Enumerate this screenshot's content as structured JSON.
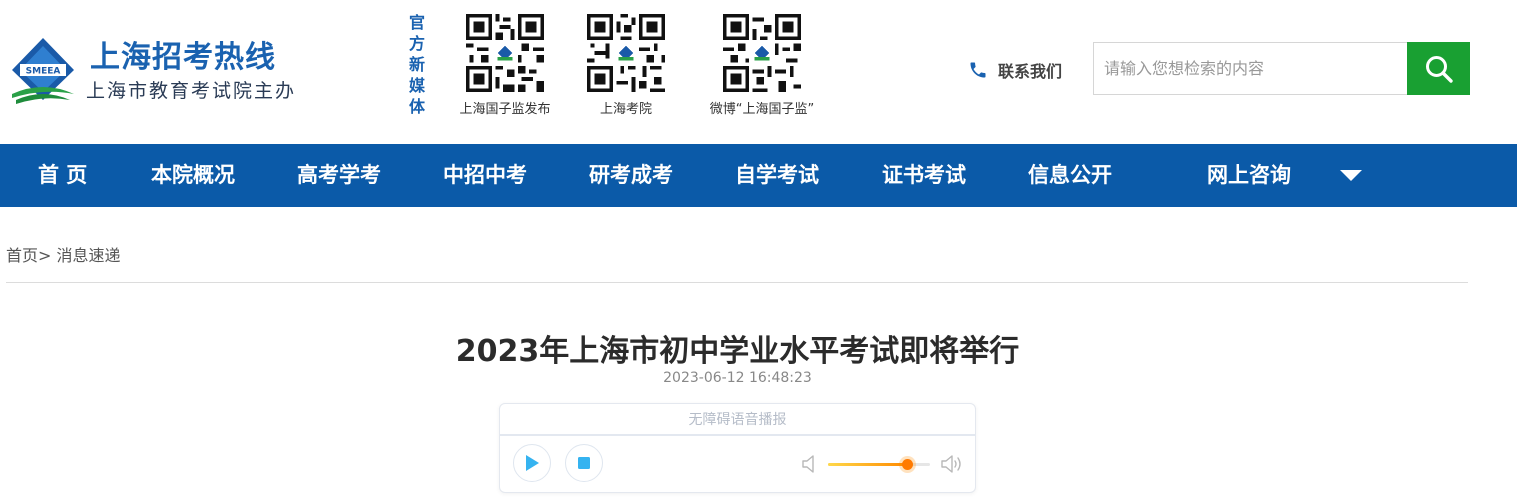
{
  "header": {
    "logo_title": "上海招考热线",
    "logo_subtitle": "上海市教育考试院主办",
    "logo_emblem_text": "SMEEA",
    "media_label": "官方新媒体",
    "qr_codes": [
      {
        "caption": "上海国子监发布"
      },
      {
        "caption": "上海考院"
      },
      {
        "caption": "微博“上海国子监”"
      }
    ],
    "contact_label": "联系我们",
    "search_placeholder": "请输入您想检索的内容"
  },
  "nav": {
    "items": [
      {
        "label": "首 页"
      },
      {
        "label": "本院概况"
      },
      {
        "label": "高考学考"
      },
      {
        "label": "中招中考"
      },
      {
        "label": "研考成考"
      },
      {
        "label": "自学考试"
      },
      {
        "label": "证书考试"
      },
      {
        "label": "信息公开"
      },
      {
        "label": "网上咨询"
      }
    ]
  },
  "breadcrumb": {
    "home": "首页",
    "separator": ">",
    "current": "消息速递"
  },
  "article": {
    "title": "2023年上海市初中学业水平考试即将举行",
    "date": "2023-06-12 16:48:23"
  },
  "player": {
    "title": "无障碍语音播报",
    "volume_level": 0.77
  },
  "colors": {
    "brand_blue": "#0b5aa8",
    "logo_blue": "#1a62b0",
    "search_green": "#19a032",
    "volume_orange": "#ff7a00",
    "player_accent": "#35b3f0"
  },
  "icons": [
    "logo-emblem-icon",
    "phone-icon",
    "search-icon",
    "chevron-down-icon",
    "play-icon",
    "stop-icon",
    "volume-low-icon",
    "volume-high-icon",
    "qr-code-icon"
  ]
}
